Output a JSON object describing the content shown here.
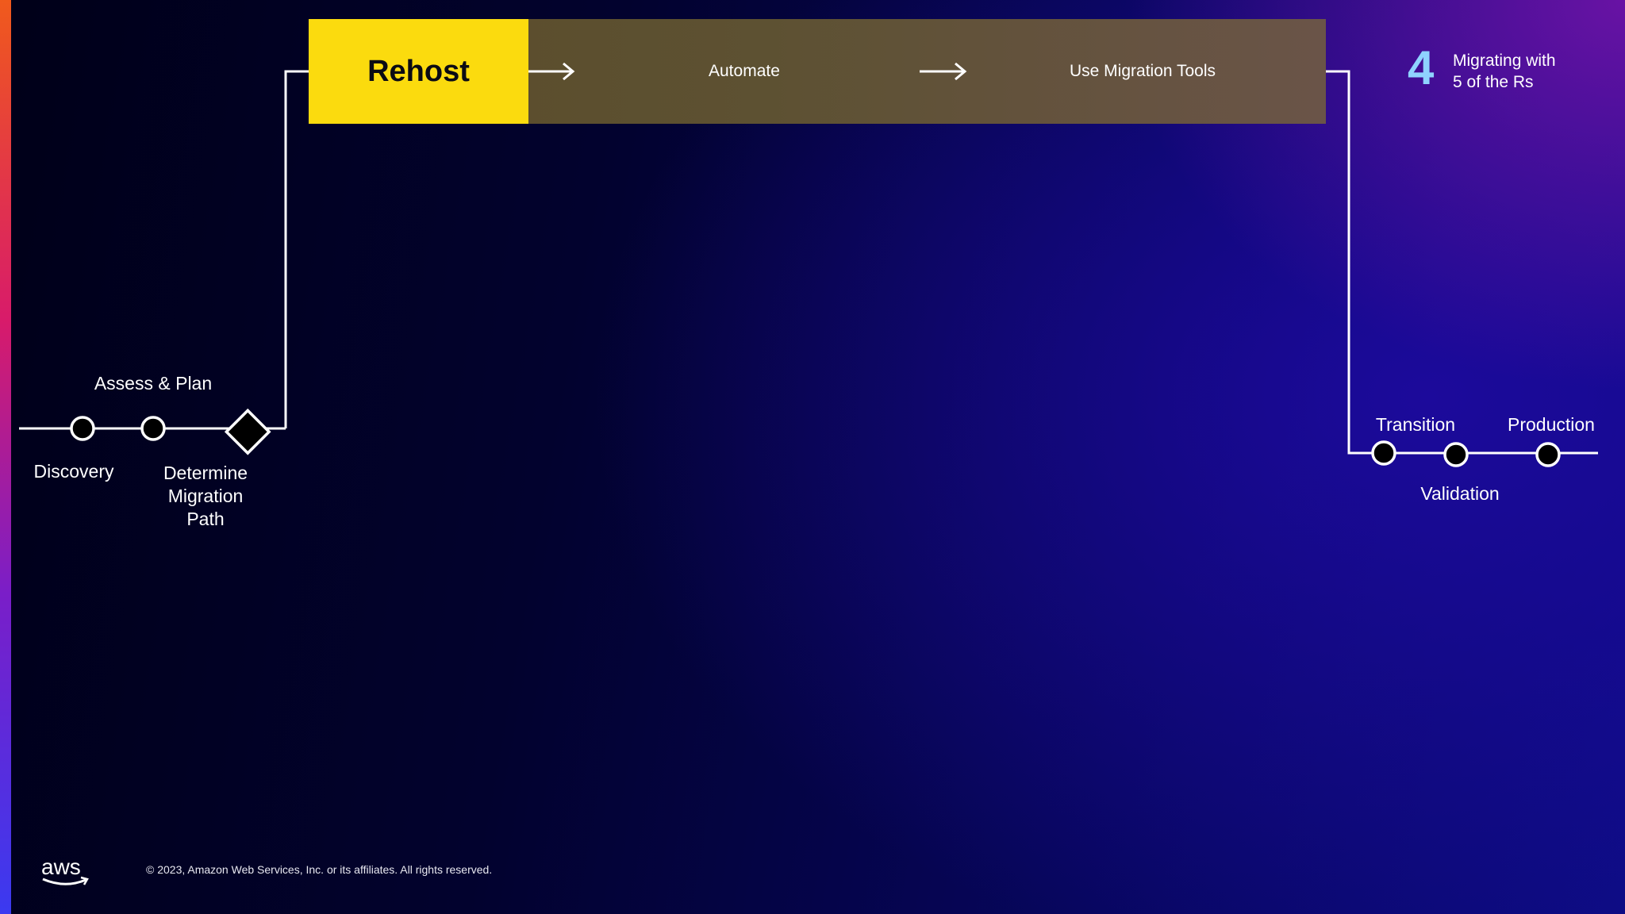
{
  "header": {
    "section_number": "4",
    "section_title_line1": "Migrating with",
    "section_title_line2": "5 of the Rs"
  },
  "banner": {
    "strategy": "Rehost",
    "step1": "Automate",
    "step2": "Use Migration Tools",
    "strategy_color": "#fbdb0e"
  },
  "timeline": {
    "assess_plan": "Assess & Plan",
    "discovery": "Discovery",
    "determine_line1": "Determine",
    "determine_line2": "Migration",
    "determine_line3": "Path",
    "transition": "Transition",
    "production": "Production",
    "validation": "Validation"
  },
  "footer": {
    "logo_text": "aws",
    "copyright": "© 2023, Amazon Web Services, Inc. or its affiliates. All rights reserved."
  },
  "colors": {
    "accent_light_blue": "#8fd3ff",
    "line": "#ffffff"
  }
}
